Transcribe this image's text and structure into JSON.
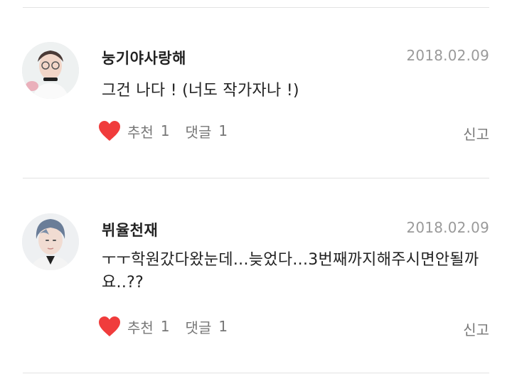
{
  "comments": [
    {
      "author": "눙기야사랑해",
      "date": "2018.02.09",
      "body": "그건 나다 ! (너도 작가자나 !)",
      "like_label": "추천",
      "like_count": "1",
      "reply_label": "댓글",
      "reply_count": "1",
      "report_label": "신고"
    },
    {
      "author": "뷔율천재",
      "date": "2018.02.09",
      "body": "ㅜㅜ학원갔다왔눈데...늦었다...3번째까지해주시면안될까요..??",
      "like_label": "추천",
      "like_count": "1",
      "reply_label": "댓글",
      "reply_count": "1",
      "report_label": "신고"
    }
  ],
  "colors": {
    "heart": "#f03c3c",
    "meta": "#9a9a9a",
    "divider": "#e3e3e3"
  },
  "icons": {
    "like": "heart-icon"
  }
}
